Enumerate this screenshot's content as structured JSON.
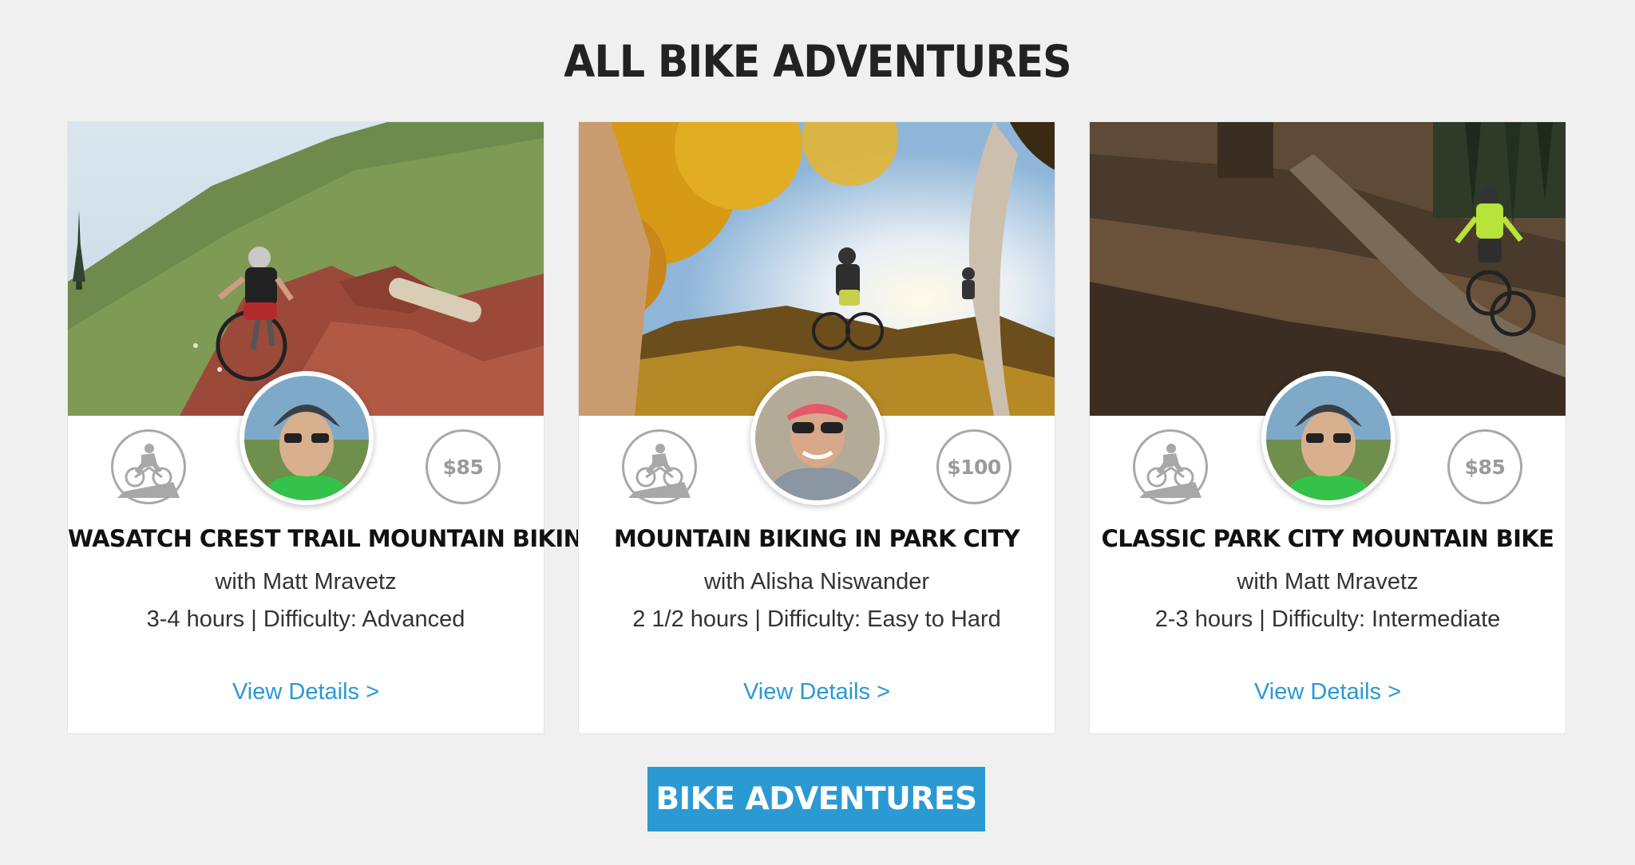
{
  "page_title": "ALL BIKE ADVENTURES",
  "icons": {
    "activity": "mountain-bike-icon"
  },
  "colors": {
    "link": "#2a98d4",
    "button": "#2b9ad3",
    "badge": "#a8a8a8"
  },
  "cards": [
    {
      "title": "WASATCH CREST TRAIL MOUNTAIN BIKING",
      "guide": "with Matt Mravetz",
      "duration": "3-4 hours",
      "difficulty": "Difficulty: Advanced",
      "price": "$85",
      "link_label": "View Details >"
    },
    {
      "title": "MOUNTAIN BIKING IN PARK CITY",
      "guide": "with Alisha Niswander",
      "duration": "2 1/2 hours",
      "difficulty": "Difficulty: Easy to Hard",
      "price": "$100",
      "link_label": "View Details >"
    },
    {
      "title": "CLASSIC PARK CITY MOUNTAIN BIKE",
      "guide": "with Matt Mravetz",
      "duration": "2-3 hours",
      "difficulty": "Difficulty: Intermediate",
      "price": "$85",
      "link_label": "View Details >"
    }
  ],
  "cta_label": "BIKE ADVENTURES"
}
